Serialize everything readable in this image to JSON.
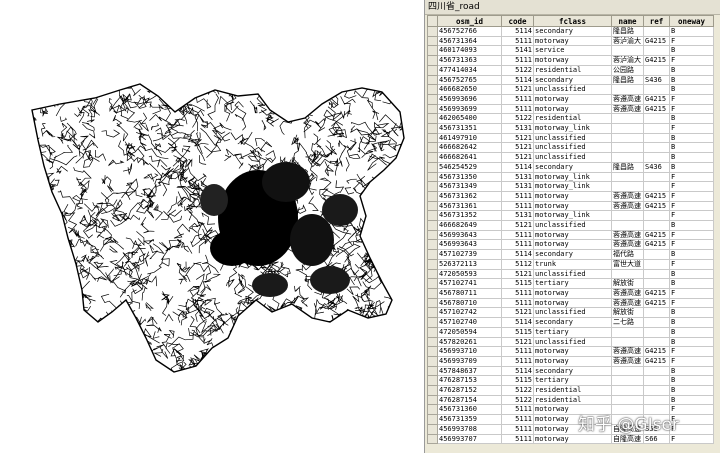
{
  "window": {
    "title": "四川省_road"
  },
  "table": {
    "columns": [
      "osm_id",
      "code",
      "fclass",
      "name",
      "ref",
      "oneway"
    ],
    "rows": [
      [
        "456752766",
        "5114",
        "secondary",
        "隆昌路",
        "",
        "B"
      ],
      [
        "456731364",
        "5111",
        "motorway",
        "蓉泸渝大",
        "G4215",
        "F"
      ],
      [
        "460174093",
        "5141",
        "service",
        "",
        "",
        "B"
      ],
      [
        "456731363",
        "5111",
        "motorway",
        "蓉泸渝大",
        "G4215",
        "F"
      ],
      [
        "477414034",
        "5122",
        "residential",
        "公园路",
        "",
        "B"
      ],
      [
        "456752765",
        "5114",
        "secondary",
        "隆昌路",
        "S436",
        "B"
      ],
      [
        "466682650",
        "5121",
        "unclassified",
        "",
        "",
        "B"
      ],
      [
        "456993696",
        "5111",
        "motorway",
        "蓉遵高速",
        "G4215",
        "F"
      ],
      [
        "456993699",
        "5111",
        "motorway",
        "蓉遵高速",
        "G4215",
        "F"
      ],
      [
        "462065400",
        "5122",
        "residential",
        "",
        "",
        "B"
      ],
      [
        "456731351",
        "5131",
        "motorway_link",
        "",
        "",
        "F"
      ],
      [
        "461497910",
        "5121",
        "unclassified",
        "",
        "",
        "B"
      ],
      [
        "466682642",
        "5121",
        "unclassified",
        "",
        "",
        "B"
      ],
      [
        "466682641",
        "5121",
        "unclassified",
        "",
        "",
        "B"
      ],
      [
        "546254529",
        "5114",
        "secondary",
        "隆昌路",
        "S436",
        "B"
      ],
      [
        "456731350",
        "5131",
        "motorway_link",
        "",
        "",
        "F"
      ],
      [
        "456731349",
        "5131",
        "motorway_link",
        "",
        "",
        "F"
      ],
      [
        "456731362",
        "5111",
        "motorway",
        "蓉遵高速",
        "G4215",
        "F"
      ],
      [
        "456731361",
        "5111",
        "motorway",
        "蓉遵高速",
        "G4215",
        "F"
      ],
      [
        "456731352",
        "5131",
        "motorway_link",
        "",
        "",
        "F"
      ],
      [
        "466682649",
        "5121",
        "unclassified",
        "",
        "",
        "B"
      ],
      [
        "456993643",
        "5111",
        "motorway",
        "蓉遵高速",
        "G4215",
        "F"
      ],
      [
        "456993643",
        "5111",
        "motorway",
        "蓉遵高速",
        "G4215",
        "F"
      ],
      [
        "457102739",
        "5114",
        "secondary",
        "福代路",
        "",
        "B"
      ],
      [
        "526372113",
        "5112",
        "trunk",
        "富世大道",
        "",
        "F"
      ],
      [
        "472050593",
        "5121",
        "unclassified",
        "",
        "",
        "B"
      ],
      [
        "457102741",
        "5115",
        "tertiary",
        "解放街",
        "",
        "B"
      ],
      [
        "456780711",
        "5111",
        "motorway",
        "蓉遵高速",
        "G4215",
        "F"
      ],
      [
        "456780710",
        "5111",
        "motorway",
        "蓉遵高速",
        "G4215",
        "F"
      ],
      [
        "457102742",
        "5121",
        "unclassified",
        "解放街",
        "",
        "B"
      ],
      [
        "457102740",
        "5114",
        "secondary",
        "二七路",
        "",
        "B"
      ],
      [
        "472050594",
        "5115",
        "tertiary",
        "",
        "",
        "B"
      ],
      [
        "457820261",
        "5121",
        "unclassified",
        "",
        "",
        "B"
      ],
      [
        "456993710",
        "5111",
        "motorway",
        "蓉遵高速",
        "G4215",
        "F"
      ],
      [
        "456993709",
        "5111",
        "motorway",
        "蓉遵高速",
        "G4215",
        "F"
      ],
      [
        "457848637",
        "5114",
        "secondary",
        "",
        "",
        "B"
      ],
      [
        "476287153",
        "5115",
        "tertiary",
        "",
        "",
        "B"
      ],
      [
        "476287152",
        "5122",
        "residential",
        "",
        "",
        "B"
      ],
      [
        "476287154",
        "5122",
        "residential",
        "",
        "",
        "B"
      ],
      [
        "456731360",
        "5111",
        "motorway",
        "",
        "",
        "F"
      ],
      [
        "456731359",
        "5111",
        "motorway",
        "",
        "",
        "F"
      ],
      [
        "456993708",
        "5111",
        "motorway",
        "自隆高速",
        "S66",
        "F"
      ],
      [
        "456993707",
        "5111",
        "motorway",
        "自隆高速",
        "S66",
        "F"
      ]
    ]
  },
  "watermark": "知乎 @GIser"
}
